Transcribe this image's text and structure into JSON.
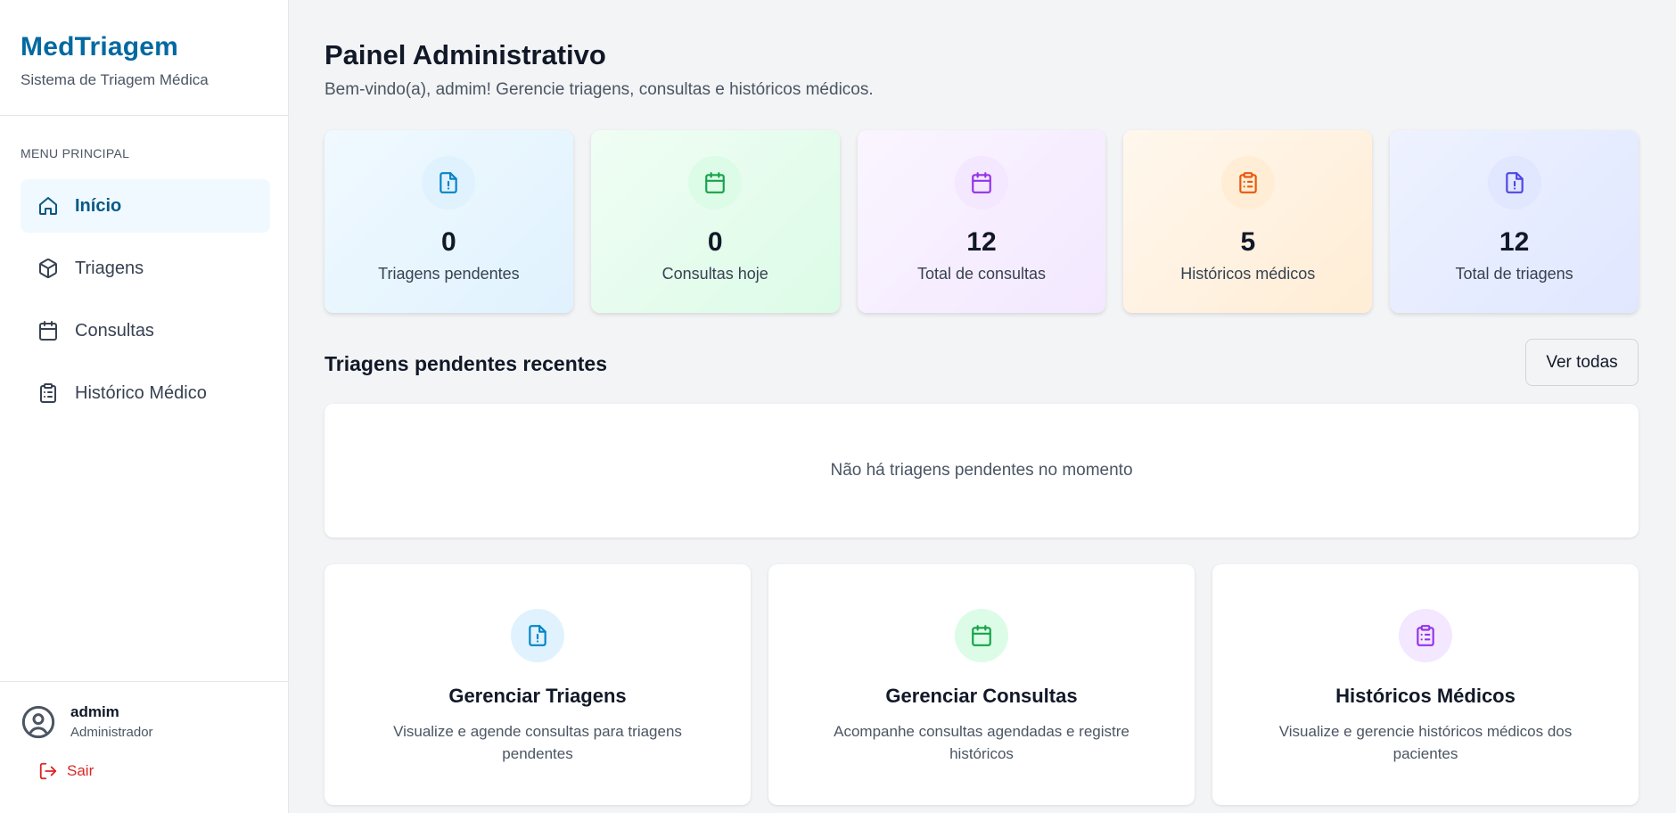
{
  "brand": {
    "title": "MedTriagem",
    "subtitle": "Sistema de Triagem Médica"
  },
  "sidebar": {
    "menu_label": "MENU PRINCIPAL",
    "items": [
      {
        "label": "Início",
        "icon": "home-icon",
        "active": true
      },
      {
        "label": "Triagens",
        "icon": "cube-icon",
        "active": false
      },
      {
        "label": "Consultas",
        "icon": "calendar-icon",
        "active": false
      },
      {
        "label": "Histórico Médico",
        "icon": "clipboard-icon",
        "active": false
      }
    ]
  },
  "user": {
    "name": "admim",
    "role": "Administrador",
    "logout_label": "Sair"
  },
  "header": {
    "title": "Painel Administrativo",
    "subtitle": "Bem-vindo(a), admim! Gerencie triagens, consultas e históricos médicos."
  },
  "stats": [
    {
      "value": "0",
      "label": "Triagens pendentes",
      "icon": "file-alert-icon",
      "color": "#0284c7"
    },
    {
      "value": "0",
      "label": "Consultas hoje",
      "icon": "calendar-icon",
      "color": "#16a34a"
    },
    {
      "value": "12",
      "label": "Total de consultas",
      "icon": "calendar-icon",
      "color": "#9333ea"
    },
    {
      "value": "5",
      "label": "Históricos médicos",
      "icon": "clipboard-icon",
      "color": "#ea580c"
    },
    {
      "value": "12",
      "label": "Total de triagens",
      "icon": "file-alert-icon",
      "color": "#4f46e5"
    }
  ],
  "recent": {
    "title": "Triagens pendentes recentes",
    "view_all_label": "Ver todas",
    "empty_text": "Não há triagens pendentes no momento"
  },
  "actions": [
    {
      "title": "Gerenciar Triagens",
      "description": "Visualize e agende consultas para triagens pendentes",
      "icon": "file-alert-icon",
      "color": "#0284c7"
    },
    {
      "title": "Gerenciar Consultas",
      "description": "Acompanhe consultas agendadas e registre históricos",
      "icon": "calendar-icon",
      "color": "#16a34a"
    },
    {
      "title": "Históricos Médicos",
      "description": "Visualize e gerencie históricos médicos dos pacientes",
      "icon": "clipboard-icon",
      "color": "#9333ea"
    }
  ]
}
